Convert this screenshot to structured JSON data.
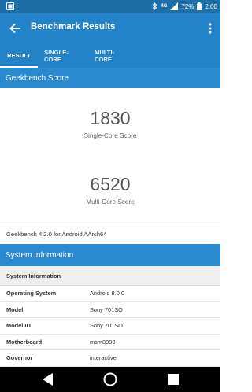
{
  "status_bar": {
    "network": "4G",
    "battery": "72%",
    "time": "2:00"
  },
  "app_bar": {
    "title": "Benchmark Results"
  },
  "tabs": [
    {
      "label": "RESULT",
      "active": true
    },
    {
      "label": "SINGLE-CORE",
      "active": false
    },
    {
      "label": "MULTI-CORE",
      "active": false
    }
  ],
  "score_section": {
    "header": "Geekbench Score",
    "single_core_score": "1830",
    "single_core_label": "Single-Core Score",
    "multi_core_score": "6520",
    "multi_core_label": "Multi-Core Score"
  },
  "version_text": "Geekbench 4.2.0 for Android AArch64",
  "system_section": {
    "header": "System Information",
    "table_title": "System Information",
    "rows": [
      {
        "key": "Operating System",
        "value": "Android 8.0.0"
      },
      {
        "key": "Model",
        "value": "Sony 701SO"
      },
      {
        "key": "Model ID",
        "value": "Sony 701SO"
      },
      {
        "key": "Motherboard",
        "value": "msm8998"
      },
      {
        "key": "Governor",
        "value": "interactive"
      }
    ]
  },
  "colors": {
    "status_bar": "#1e6ea8",
    "app_bar": "#2283c8",
    "section_header": "#2a8ad0"
  },
  "icons": [
    "notification-icon",
    "bluetooth-icon",
    "signal-icon",
    "battery-icon",
    "back-arrow-icon",
    "more-vert-icon",
    "nav-back-icon",
    "nav-home-icon",
    "nav-recents-icon"
  ]
}
